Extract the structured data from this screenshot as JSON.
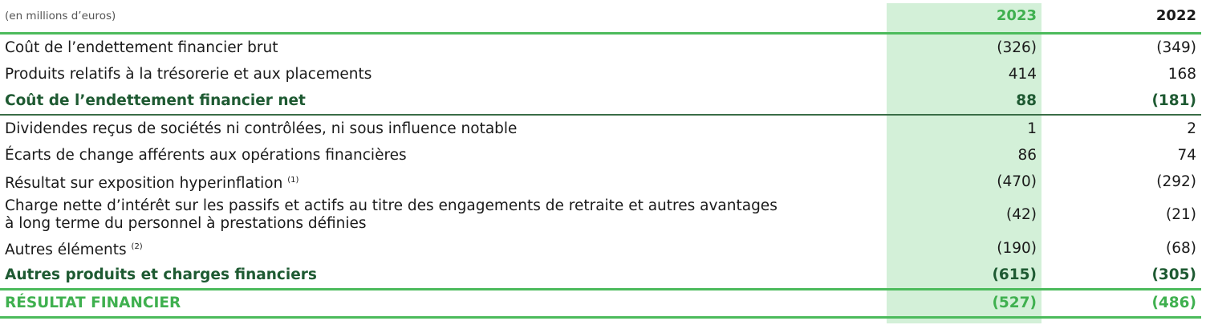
{
  "header": {
    "unit": "(en millions d’euros)",
    "year1": "2023",
    "year2": "2022"
  },
  "rows": [
    {
      "label": "Coût de l’endettement financier brut",
      "note": "",
      "v2023": "(326)",
      "v2022": "(349)"
    },
    {
      "label": "Produits relatifs à la trésorerie et aux placements",
      "note": "",
      "v2023": "414",
      "v2022": "168"
    },
    {
      "label": "Coût de l’endettement financier net",
      "note": "",
      "v2023": "88",
      "v2022": "(181)"
    },
    {
      "label": "Dividendes reçus de sociétés ni contrôlées, ni sous influence notable",
      "note": "",
      "v2023": "1",
      "v2022": "2"
    },
    {
      "label": "Écarts de change afférents aux opérations financières",
      "note": "",
      "v2023": "86",
      "v2022": "74"
    },
    {
      "label": "Résultat sur exposition hyperinflation ",
      "note": "(1)",
      "v2023": "(470)",
      "v2022": "(292)"
    },
    {
      "label_line1": "Charge nette d’intérêt sur les passifs et actifs au titre des engagements de retraite et autres avantages",
      "label_line2": "à long terme du personnel à prestations définies",
      "v2023": "(42)",
      "v2022": "(21)"
    },
    {
      "label": "Autres éléments ",
      "note": "(2)",
      "v2023": "(190)",
      "v2022": "(68)"
    },
    {
      "label": "Autres produits et charges financiers",
      "note": "",
      "v2023": "(615)",
      "v2022": "(305)"
    },
    {
      "label": "RÉSULTAT FINANCIER",
      "note": "",
      "v2023": "(527)",
      "v2022": "(486)"
    }
  ],
  "colors": {
    "accent_green": "#3fb04f",
    "highlight_column": "#d3f0d8",
    "dark_green": "#1e5a32"
  }
}
